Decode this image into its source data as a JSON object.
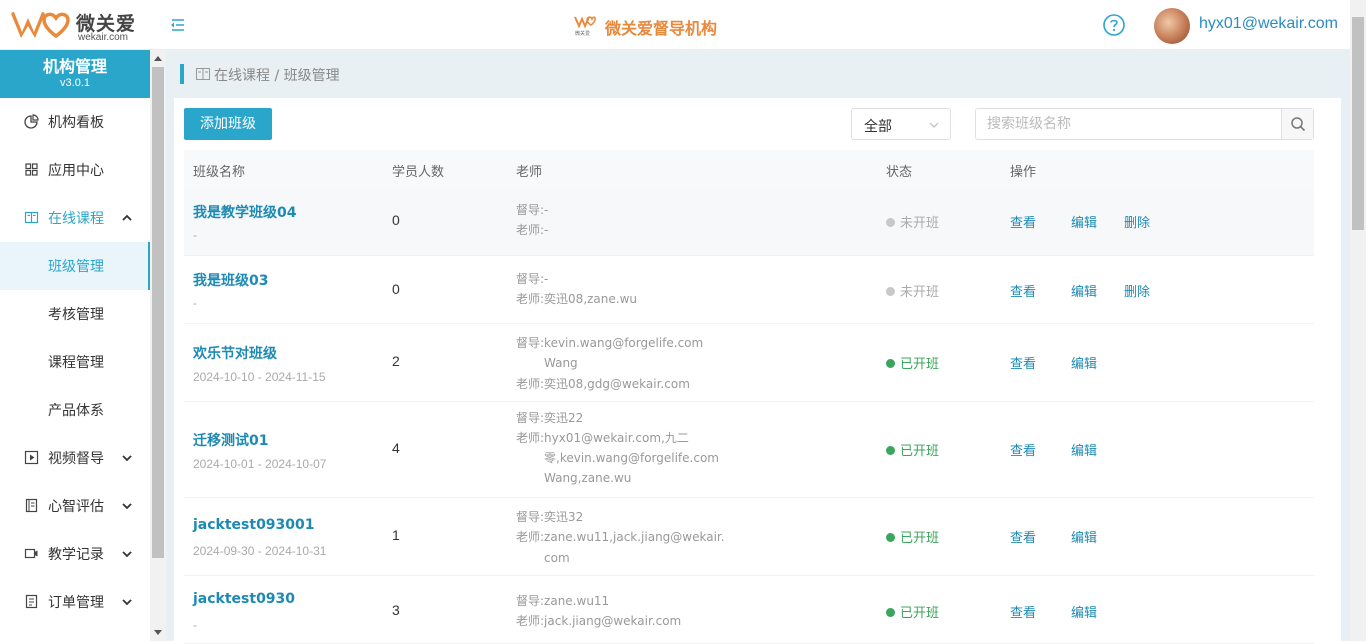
{
  "header": {
    "logo_text": "微关爱",
    "logo_domain": "wekair.com",
    "brand_title": "微关爱督导机构",
    "brand_mark_text": "微关爱",
    "user_name": "hyx01@wekair.com",
    "accent_color": "#2ba6cb",
    "brand_color": "#e8893c"
  },
  "sidebar": {
    "org_title": "机构管理",
    "version": "v3.0.1",
    "items": [
      {
        "label": "机构看板",
        "icon": "pie-chart-icon"
      },
      {
        "label": "应用中心",
        "icon": "grid-icon"
      },
      {
        "label": "在线课程",
        "icon": "book-icon",
        "expanded": true
      },
      {
        "label": "班级管理",
        "sub": true,
        "selected": true
      },
      {
        "label": "考核管理",
        "sub": true
      },
      {
        "label": "课程管理",
        "sub": true
      },
      {
        "label": "产品体系",
        "sub": true
      },
      {
        "label": "视频督导",
        "icon": "play-icon"
      },
      {
        "label": "心智评估",
        "icon": "notebook-icon"
      },
      {
        "label": "教学记录",
        "icon": "video-record-icon"
      },
      {
        "label": "订单管理",
        "icon": "receipt-icon"
      }
    ]
  },
  "breadcrumb": "在线课程 / 班级管理",
  "toolbar": {
    "add_label": "添加班级",
    "status_filter": "全部",
    "search_placeholder": "搜索班级名称"
  },
  "table": {
    "columns": [
      "班级名称",
      "学员人数",
      "老师",
      "状态",
      "操作"
    ],
    "actions": {
      "view": "查看",
      "edit": "编辑",
      "delete": "删除"
    },
    "rows": [
      {
        "name": "我是教学班级04",
        "date": "-",
        "count": "0",
        "teacher_lines": [
          "督导:-",
          "老师:-"
        ],
        "status": "未开班",
        "active": false,
        "deletable": true
      },
      {
        "name": "我是班级03",
        "date": "-",
        "count": "0",
        "teacher_lines": [
          "督导:-",
          "老师:奕迅08,zane.wu"
        ],
        "status": "未开班",
        "active": false,
        "deletable": true
      },
      {
        "name": "欢乐节对班级",
        "date": "2024-10-10 - 2024-11-15",
        "count": "2",
        "teacher_lines": [
          "督导:kevin.wang@forgelife.com",
          "Wang",
          "老师:奕迅08,gdg@wekair.com"
        ],
        "status": "已开班",
        "active": true,
        "deletable": false
      },
      {
        "name": "迁移测试01",
        "date": "2024-10-01 - 2024-10-07",
        "count": "4",
        "teacher_lines": [
          "督导:奕迅22",
          "老师:hyx01@wekair.com,九二",
          "零,kevin.wang@forgelife.com",
          "Wang,zane.wu"
        ],
        "status": "已开班",
        "active": true,
        "deletable": false
      },
      {
        "name": "jacktest093001",
        "date": "2024-09-30 - 2024-10-31",
        "count": "1",
        "teacher_lines": [
          "督导:奕迅32",
          "老师:zane.wu11,jack.jiang@wekair.",
          "com"
        ],
        "status": "已开班",
        "active": true,
        "deletable": false
      },
      {
        "name": "jacktest0930",
        "date": "-",
        "count": "3",
        "teacher_lines": [
          "督导:zane.wu11",
          "老师:jack.jiang@wekair.com"
        ],
        "status": "已开班",
        "active": true,
        "deletable": false
      }
    ]
  }
}
